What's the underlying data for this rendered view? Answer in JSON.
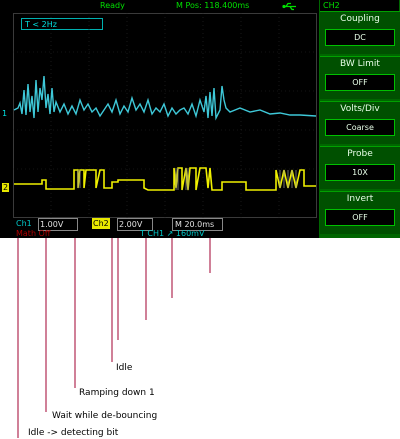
{
  "status": {
    "ready": "Ready",
    "m_pos": "M Pos: 118.400ms",
    "usb_icon": "usb-icon"
  },
  "trigger_label": "T    <  2Hz",
  "channel_markers": {
    "ch1": "1",
    "ch2": "2"
  },
  "bottom_bar": {
    "ch1_label": "Ch1",
    "ch1_volts": "1.00V",
    "ch2_label": "Ch2",
    "ch2_volts": "2.00V",
    "m_time": "M 20.0ms",
    "math_label": "Math  Off",
    "trigger_info": "T  CH1  ↗  160mV"
  },
  "sidebar": {
    "title": "CH2",
    "items": [
      {
        "label": "Coupling",
        "value": "DC"
      },
      {
        "label": "BW Limit",
        "value": "OFF"
      },
      {
        "label": "Volts/Div",
        "value": "Coarse"
      },
      {
        "label": "Probe",
        "value": "10X"
      },
      {
        "label": "Invert",
        "value": "OFF"
      }
    ]
  },
  "annotations": [
    {
      "label": "Idle"
    },
    {
      "label": "Ramping down 1"
    },
    {
      "label": "Wait while de-bouncing"
    },
    {
      "label": "Idle -> detecting bit"
    }
  ],
  "colors": {
    "ch1_trace": "#3ec8d8",
    "ch2_trace": "#f0f000",
    "annotation_line": "#a00030",
    "sidebar_bg": "#006600"
  }
}
